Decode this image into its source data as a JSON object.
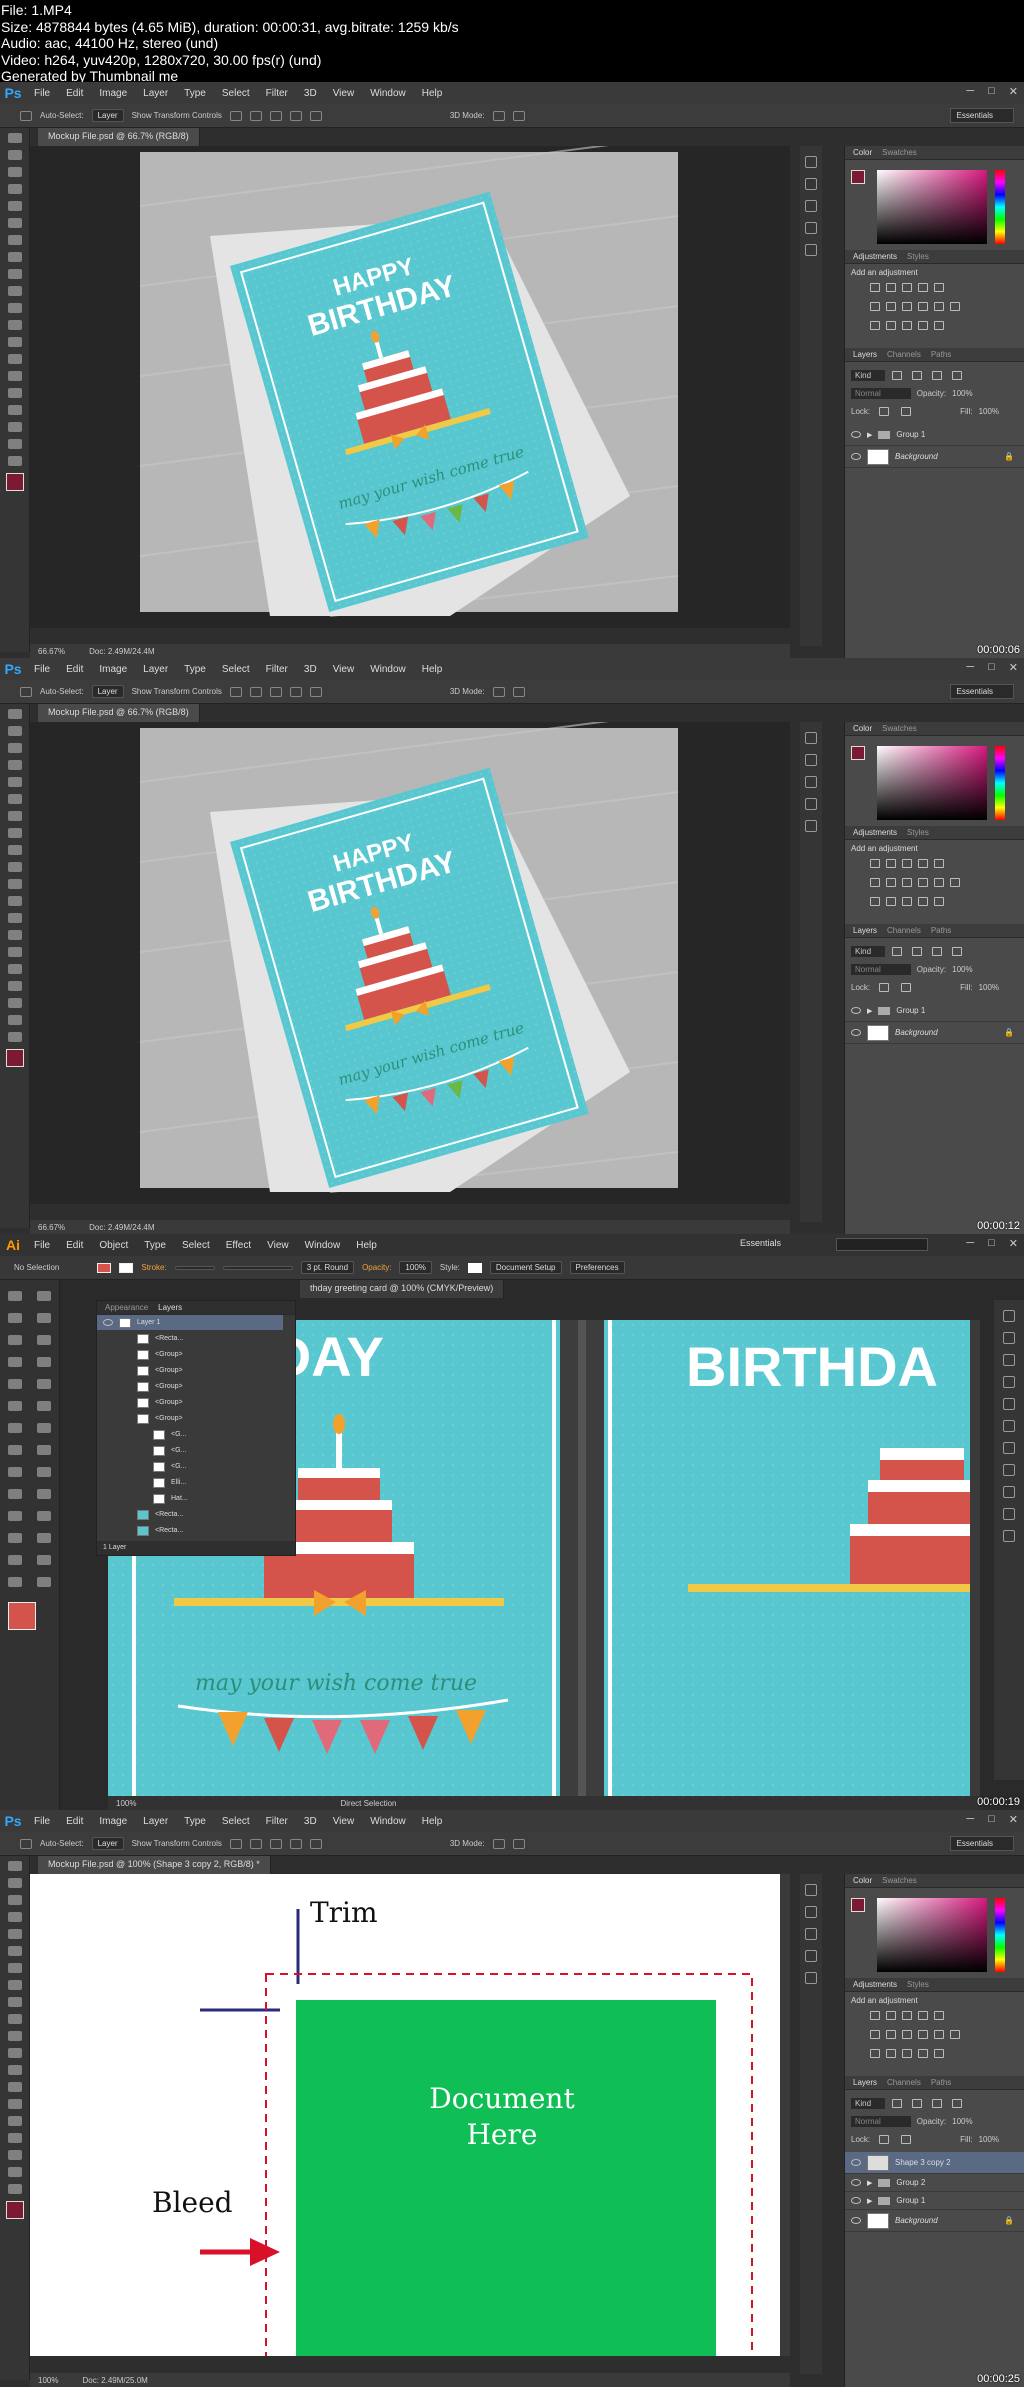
{
  "file_info": {
    "lines": [
      "File: 1.MP4",
      "Size: 4878844 bytes (4.65 MiB), duration: 00:00:31, avg.bitrate: 1259 kb/s",
      "Audio: aac, 44100 Hz, stereo (und)",
      "Video: h264, yuv420p, 1280x720, 30.00 fps(r) (und)",
      "Generated by Thumbnail me"
    ]
  },
  "ps_menu": [
    "File",
    "Edit",
    "Image",
    "Layer",
    "Type",
    "Select",
    "Filter",
    "3D",
    "View",
    "Window",
    "Help"
  ],
  "ai_menu": [
    "File",
    "Edit",
    "Object",
    "Type",
    "Select",
    "Effect",
    "View",
    "Window",
    "Help"
  ],
  "ps_logo": "Ps",
  "ai_logo": "Ai",
  "options": {
    "auto_select": "Auto-Select:",
    "layer": "Layer",
    "show_transform": "Show Transform Controls",
    "mode_3d": "3D Mode:",
    "workspace": "Essentials"
  },
  "ai_options": {
    "no_selection": "No Selection",
    "stroke": "Stroke:",
    "round": "3 pt. Round",
    "opacity": "Opacity:",
    "opacity_val": "100%",
    "style": "Style:",
    "doc_setup": "Document Setup",
    "prefs": "Preferences",
    "workspace": "Essentials"
  },
  "doc_tab_1": "Mockup File.psd @ 66.7% (RGB/8)",
  "doc_tab_4": "Mockup File.psd @ 100% (Shape 3 copy 2, RGB/8) *",
  "ai_doc_tab": "thday greeting card @ 100% (CMYK/Preview)",
  "ai_tabs": [
    "Appearance",
    "Layers"
  ],
  "ai_layers": [
    "Layer 1",
    "<Recta...",
    "<Group>",
    "<Group>",
    "<Group>",
    "<Group>",
    "<Group>",
    "<G...",
    "<G...",
    "<G...",
    "Elli...",
    "Hat...",
    "<Recta...",
    "<Recta..."
  ],
  "ai_layer_count": "1 Layer",
  "ai_zoom": "100%",
  "ai_status_tool": "Direct Selection",
  "status_zoom_1": "66.67%",
  "status_doc_1": "Doc: 2.49M/24.4M",
  "status_zoom_4": "100%",
  "status_doc_4": "Doc: 2.49M/25.0M",
  "panels": {
    "color_tab": "Color",
    "swatches_tab": "Swatches",
    "adjustments_tab": "Adjustments",
    "styles_tab": "Styles",
    "add_adjustment": "Add an adjustment",
    "layers_tab": "Layers",
    "channels_tab": "Channels",
    "paths_tab": "Paths",
    "kind": "Kind",
    "normal": "Normal",
    "opacity": "Opacity:",
    "opacity_val": "100%",
    "lock": "Lock:",
    "fill": "Fill:",
    "fill_val": "100%"
  },
  "layers_12": [
    "Group 1",
    "Background"
  ],
  "layers_4": [
    "Shape 3 copy 2",
    "Group 2",
    "Group 1",
    "Background"
  ],
  "card": {
    "happy": "HAPPY",
    "birthday": "BIRTHDAY",
    "wish": "may your wish come true"
  },
  "ai_card": {
    "left_text": "THDAY",
    "right_text": "BIRTHDA",
    "wish": "may your wish come true"
  },
  "diagram": {
    "trim": "Trim",
    "bleed": "Bleed",
    "doc_line1": "Document",
    "doc_line2": "Here"
  },
  "timestamps": [
    "00:00:06",
    "00:00:12",
    "00:00:19",
    "00:00:25"
  ],
  "colors": {
    "card_teal": "#58c7cf",
    "cake_red": "#d4534a",
    "doc_green": "#0fbf55",
    "bleed_red": "#d8102a",
    "trim_navy": "#2a2a7a"
  }
}
